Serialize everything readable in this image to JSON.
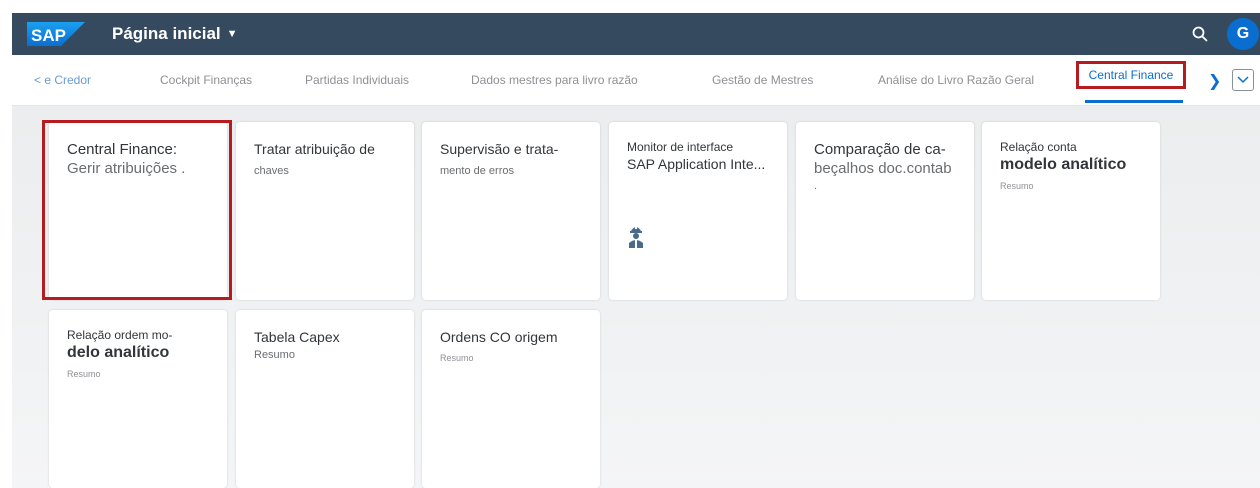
{
  "shell": {
    "logo_text": "SAP",
    "title": "Página inicial",
    "avatar_initial": "G",
    "colors": {
      "header_bg": "#354a5f",
      "accent": "#0a6ed1",
      "highlight": "#b51c20"
    }
  },
  "tabs": {
    "items": [
      {
        "label": "< e Credor"
      },
      {
        "label": "Cockpit Finanças"
      },
      {
        "label": "Partidas Individuais"
      },
      {
        "label": "Dados mestres para livro razão"
      },
      {
        "label": "Gestão de Mestres"
      },
      {
        "label": "Análise do Livro Razão Geral"
      }
    ],
    "active": "Central Finance",
    "scroll_right_icon": "chevron-right-icon",
    "overflow_icon": "chevron-down-icon"
  },
  "tiles": [
    {
      "title": "Central Finance:",
      "subtitle": "Gerir atribuições ."
    },
    {
      "title": "Tratar atribuição de",
      "subtitle": "chaves"
    },
    {
      "title": "Supervisão e trata-",
      "subtitle": "mento de erros"
    },
    {
      "title": "Monitor de interface",
      "subtitle": "SAP Application Inte...",
      "icon": "worker-icon"
    },
    {
      "title": "Comparação de ca-",
      "subtitle": "beçalhos doc.contab",
      "extra": "."
    },
    {
      "title": "Relação conta",
      "subtitle": "modelo analítico",
      "info": "Resumo"
    },
    {
      "title": "Relação ordem mo-",
      "subtitle": "delo analítico",
      "info": "Resumo"
    },
    {
      "title": "Tabela Capex",
      "info": "Resumo"
    },
    {
      "title": "Ordens CO origem",
      "info": "Resumo"
    }
  ]
}
